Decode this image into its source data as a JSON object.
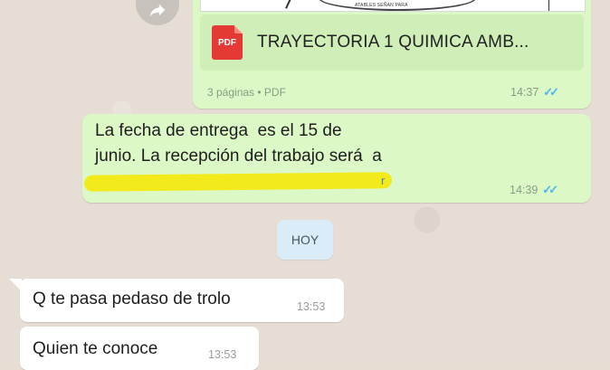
{
  "document_message": {
    "preview_tiny_text": "ATABLES SEÑAN PARA",
    "pdf_badge": "PDF",
    "file_name": "TRAYECTORIA 1 QUIMICA AMB...",
    "meta": "3 páginas • PDF",
    "time": "14:37",
    "status_ticks": "✓✓"
  },
  "text_message": {
    "line1": "La fecha de entrega  es el 15 de",
    "line2": "junio. La recepción del trabajo será  a",
    "partial_visible": "r",
    "time": "14:39",
    "status_ticks": "✓✓"
  },
  "date_separator": "HOY",
  "incoming_messages": [
    {
      "text": "Q te pasa pedaso de trolo",
      "time": "13:53"
    },
    {
      "text": "Quien te conoce",
      "time": "13:53"
    }
  ],
  "colors": {
    "outgoing_bubble": "#dcf8c6",
    "incoming_bubble": "#ffffff",
    "read_ticks": "#4fb6ec",
    "pdf_icon": "#e53935",
    "redaction_highlight": "#f2ea1a"
  },
  "icons": {
    "forward": "forward-arrow-icon",
    "pdf": "pdf-file-icon",
    "read_receipt": "double-check-icon"
  }
}
